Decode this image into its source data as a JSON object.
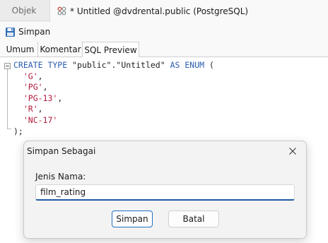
{
  "tabs": {
    "objek_label": "Objek",
    "active_label": "* Untitled @dvdrental.public (PostgreSQL)"
  },
  "toolbar": {
    "save_label": "Simpan"
  },
  "subtabs": [
    {
      "label": "Umum"
    },
    {
      "label": "Komentar"
    },
    {
      "label": "SQL Preview"
    }
  ],
  "editor": {
    "lines": [
      [
        {
          "t": "CREATE TYPE ",
          "c": "kw"
        },
        {
          "t": "\"public\".\"Untitled\" ",
          "c": "plain"
        },
        {
          "t": "AS ENUM",
          "c": "kw"
        },
        {
          "t": " (",
          "c": "plain"
        }
      ],
      [
        {
          "t": "  ",
          "c": "plain"
        },
        {
          "t": "'G'",
          "c": "str"
        },
        {
          "t": ",",
          "c": "plain"
        }
      ],
      [
        {
          "t": "  ",
          "c": "plain"
        },
        {
          "t": "'PG'",
          "c": "str"
        },
        {
          "t": ",",
          "c": "plain"
        }
      ],
      [
        {
          "t": "  ",
          "c": "plain"
        },
        {
          "t": "'PG-13'",
          "c": "str"
        },
        {
          "t": ",",
          "c": "plain"
        }
      ],
      [
        {
          "t": "  ",
          "c": "plain"
        },
        {
          "t": "'R'",
          "c": "str"
        },
        {
          "t": ",",
          "c": "plain"
        }
      ],
      [
        {
          "t": "  ",
          "c": "plain"
        },
        {
          "t": "'NC-17'",
          "c": "str"
        }
      ],
      [
        {
          "t": ");",
          "c": "plain"
        }
      ]
    ]
  },
  "dialog": {
    "title": "Simpan Sebagai",
    "field_label": "Jenis Nama:",
    "field_value": "film_rating",
    "save_label": "Simpan",
    "cancel_label": "Batal"
  },
  "colors": {
    "keyword": "#2a5db0",
    "string": "#b11a3b",
    "accent": "#1f5aa8"
  }
}
